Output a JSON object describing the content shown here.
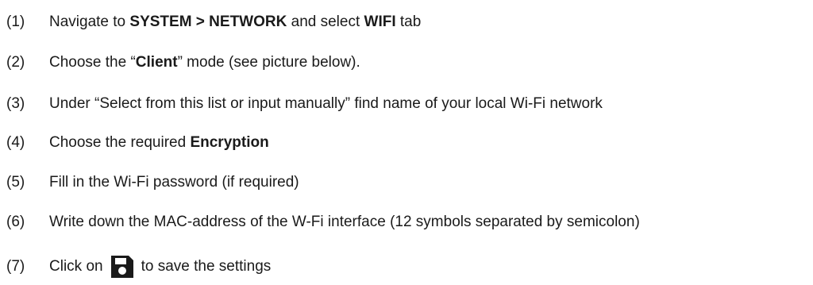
{
  "steps": [
    {
      "number": "(1)",
      "parts": [
        "Navigate to ",
        "SYSTEM > NETWORK",
        " and select ",
        "WIFI",
        " tab"
      ]
    },
    {
      "number": "(2)",
      "parts": [
        "Choose the “",
        "Client",
        "” mode (see picture below)."
      ]
    },
    {
      "number": "(3)",
      "text": "Under “Select from this list or input manually” find name of your local Wi-Fi network"
    },
    {
      "number": "(4)",
      "parts": [
        "Choose the required ",
        "Encryption"
      ]
    },
    {
      "number": "(5)",
      "text": "Fill in the Wi-Fi password (if required)"
    },
    {
      "number": "(6)",
      "text": "Write down the MAC-address of the W-Fi interface (12 symbols separated by semicolon)"
    },
    {
      "number": "(7)",
      "before_icon": "Click on",
      "icon": "save-icon",
      "after_icon": "to save the settings"
    }
  ]
}
